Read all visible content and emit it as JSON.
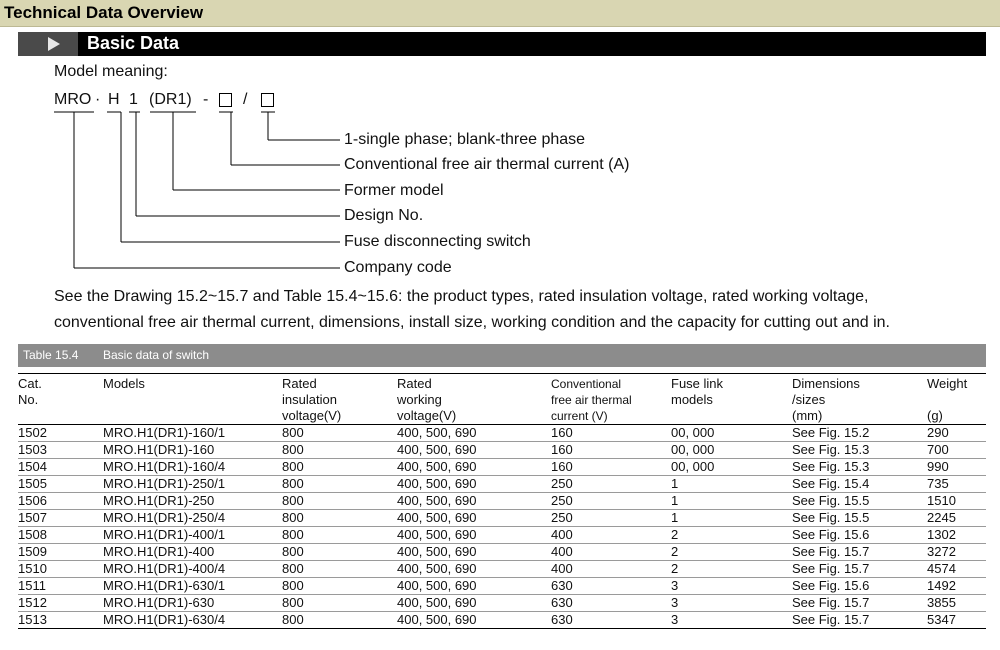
{
  "header": {
    "title": "Technical Data Overview"
  },
  "section": {
    "title": "Basic Data"
  },
  "model": {
    "label": "Model meaning:",
    "code": {
      "mro": "MRO",
      "dot": "·",
      "h": "H",
      "one": "1",
      "dr1": "(DR1)",
      "dash": "-",
      "slash": "/"
    },
    "legend": [
      "1-single phase; blank-three phase",
      "Conventional free air thermal current (A)",
      "Former model",
      "Design No.",
      "Fuse disconnecting switch",
      "Company code"
    ]
  },
  "description": {
    "line1": "See the Drawing 15.2~15.7 and Table 15.4~15.6: the product types, rated insulation voltage, rated working voltage,",
    "line2": "conventional  free air thermal current, dimensions, install size, working condition and the capacity for cutting out and in."
  },
  "table": {
    "number": "Table 15.4",
    "caption": "Basic data of switch",
    "headers": [
      [
        "Cat.",
        "No.",
        ""
      ],
      [
        "Models",
        "",
        ""
      ],
      [
        "Rated",
        "insulation",
        "voltage(V)"
      ],
      [
        "Rated",
        "working",
        "voltage(V)"
      ],
      [
        "Conventional",
        "free air thermal",
        "current (V)"
      ],
      [
        "Fuse link",
        "models",
        ""
      ],
      [
        "Dimensions",
        "/sizes",
        "(mm)"
      ],
      [
        "Weight",
        "",
        "(g)"
      ]
    ],
    "rows": [
      [
        "1502",
        "MRO.H1(DR1)-160/1",
        "800",
        "400, 500, 690",
        "160",
        "00, 000",
        "See Fig. 15.2",
        "290"
      ],
      [
        "1503",
        "MRO.H1(DR1)-160",
        "800",
        "400, 500, 690",
        "160",
        "00, 000",
        "See Fig. 15.3",
        "700"
      ],
      [
        "1504",
        "MRO.H1(DR1)-160/4",
        "800",
        "400, 500, 690",
        "160",
        "00, 000",
        "See Fig. 15.3",
        "990"
      ],
      [
        "1505",
        "MRO.H1(DR1)-250/1",
        "800",
        "400, 500, 690",
        "250",
        "1",
        "See Fig. 15.4",
        "735"
      ],
      [
        "1506",
        "MRO.H1(DR1)-250",
        "800",
        "400, 500, 690",
        "250",
        "1",
        "See Fig. 15.5",
        "1510"
      ],
      [
        "1507",
        "MRO.H1(DR1)-250/4",
        "800",
        "400, 500, 690",
        "250",
        "1",
        "See Fig. 15.5",
        "2245"
      ],
      [
        "1508",
        "MRO.H1(DR1)-400/1",
        "800",
        "400, 500, 690",
        "400",
        "2",
        "See Fig. 15.6",
        "1302"
      ],
      [
        "1509",
        "MRO.H1(DR1)-400",
        "800",
        "400, 500, 690",
        "400",
        "2",
        "See Fig. 15.7",
        "3272"
      ],
      [
        "1510",
        "MRO.H1(DR1)-400/4",
        "800",
        "400, 500, 690",
        "400",
        "2",
        "See Fig. 15.7",
        "4574"
      ],
      [
        "1511",
        "MRO.H1(DR1)-630/1",
        "800",
        "400, 500, 690",
        "630",
        "3",
        "See Fig. 15.6",
        "1492"
      ],
      [
        "1512",
        "MRO.H1(DR1)-630",
        "800",
        "400, 500, 690",
        "630",
        "3",
        "See Fig. 15.7",
        "3855"
      ],
      [
        "1513",
        "MRO.H1(DR1)-630/4",
        "800",
        "400, 500, 690",
        "630",
        "3",
        "See Fig. 15.7",
        "5347"
      ]
    ]
  }
}
